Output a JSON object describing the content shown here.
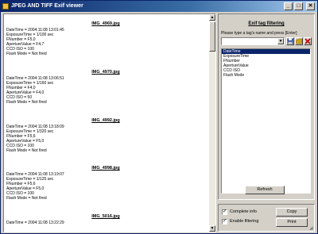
{
  "window": {
    "title": "JPEG AND TIFF Exif viewer",
    "buttons": [
      "_",
      "□",
      "✕"
    ]
  },
  "images": [
    {
      "name": "IMG_4969.jpg",
      "props": [
        "DateTime = 2004:11:08 13:01:45",
        "ExposureTime = 1/100 sec",
        "FNumber = F5,0",
        "ApertureValue = F4,7",
        "CCD ISO = 100",
        "Flash Mode = Not fired"
      ]
    },
    {
      "name": "IMG_4970.jpg",
      "props": [
        "DateTime = 2004:11:08 13:06:51",
        "ExposureTime = 1/160 sec",
        "FNumber = F4,0",
        "ApertureValue = F4,0",
        "CCD ISO = 50",
        "Flash Mode = Not fired"
      ]
    },
    {
      "name": "IMG_4992.jpg",
      "props": [
        "DateTime = 2004:11:08 13:18:09",
        "ExposureTime = 1/320 sec",
        "FNumber = F5,6",
        "ApertureValue = F5,0",
        "CCD ISO = 100",
        "Flash Mode = Not fired"
      ]
    },
    {
      "name": "IMG_4998.jpg",
      "props": [
        "DateTime = 2004:11:08 13:19:07",
        "ExposureTime = 1/125 sec",
        "FNumber = F5,6",
        "ApertureValue = F5,0",
        "CCD ISO = 100",
        "Flash Mode = Not fired"
      ]
    },
    {
      "name": "IMG_5016.jpg",
      "props": [
        "DateTime = 2004:11:08 13:22:29"
      ]
    }
  ],
  "filter": {
    "title": "Exif tag filtering",
    "hint": "Please type a tag's name and press [Enter]",
    "input_value": "",
    "tags": [
      "DateTime",
      "ExposureTime",
      "FNumber",
      "ApertureValue",
      "CCD ISO",
      "Flash Mode"
    ],
    "selected_tag": "DateTime",
    "refresh_label": "Refresh"
  },
  "options": {
    "complete_info_label": "Complete info",
    "complete_info_checked": true,
    "enable_filtering_label": "Enable filtering",
    "enable_filtering_checked": true,
    "copy_label": "Copy",
    "print_label": "Print"
  },
  "colors": {
    "title_bar": "#0a246a",
    "selection": "#0a246a",
    "face": "#d4d0c8",
    "save_icon": "#1f3f8f",
    "open_icon": "#d0a020",
    "delete_icon": "#c00000"
  }
}
